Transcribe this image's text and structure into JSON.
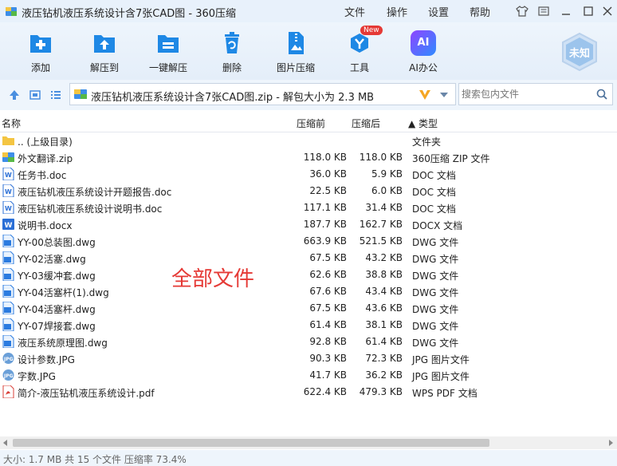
{
  "window": {
    "title": "液压钻机液压系统设计含7张CAD图 - 360压缩",
    "menu": [
      "文件",
      "操作",
      "设置",
      "帮助"
    ]
  },
  "toolbar": {
    "tools": [
      {
        "label": "添加",
        "icon": "add-icon"
      },
      {
        "label": "解压到",
        "icon": "extract-to-icon"
      },
      {
        "label": "一键解压",
        "icon": "one-click-extract-icon"
      },
      {
        "label": "删除",
        "icon": "delete-icon"
      },
      {
        "label": "图片压缩",
        "icon": "image-compress-icon"
      },
      {
        "label": "工具",
        "icon": "tools-icon",
        "badge": "New"
      },
      {
        "label": "AI办公",
        "icon": "ai-office-icon",
        "icon_text": "AI"
      }
    ],
    "profile_label": "未知"
  },
  "address": {
    "path": "液压钻机液压系统设计含7张CAD图.zip - 解包大小为 2.3 MB",
    "search_placeholder": "搜索包内文件"
  },
  "columns": {
    "name": "名称",
    "original": "压缩前",
    "compressed": "压缩后",
    "type": "▲ 类型"
  },
  "files": [
    {
      "name": ".. (上级目录)",
      "size": "",
      "compressed": "",
      "type": "文件夹",
      "icon": "folder-icon"
    },
    {
      "name": "外文翻译.zip",
      "size": "118.0 KB",
      "compressed": "118.0 KB",
      "type": "360压缩 ZIP 文件",
      "icon": "zip-file-icon"
    },
    {
      "name": "任务书.doc",
      "size": "36.0 KB",
      "compressed": "5.9 KB",
      "type": "DOC 文档",
      "icon": "word-doc-icon"
    },
    {
      "name": "液压钻机液压系统设计开题报告.doc",
      "size": "22.5 KB",
      "compressed": "6.0 KB",
      "type": "DOC 文档",
      "icon": "word-doc-icon"
    },
    {
      "name": "液压钻机液压系统设计说明书.doc",
      "size": "117.1 KB",
      "compressed": "31.4 KB",
      "type": "DOC 文档",
      "icon": "word-doc-icon"
    },
    {
      "name": "说明书.docx",
      "size": "187.7 KB",
      "compressed": "162.7 KB",
      "type": "DOCX 文档",
      "icon": "word-docx-icon"
    },
    {
      "name": "YY-00总装图.dwg",
      "size": "663.9 KB",
      "compressed": "521.5 KB",
      "type": "DWG 文件",
      "icon": "dwg-file-icon"
    },
    {
      "name": "YY-02活塞.dwg",
      "size": "67.5 KB",
      "compressed": "43.2 KB",
      "type": "DWG 文件",
      "icon": "dwg-file-icon"
    },
    {
      "name": "YY-03缓冲套.dwg",
      "size": "62.6 KB",
      "compressed": "38.8 KB",
      "type": "DWG 文件",
      "icon": "dwg-file-icon"
    },
    {
      "name": "YY-04活塞杆(1).dwg",
      "size": "67.6 KB",
      "compressed": "43.4 KB",
      "type": "DWG 文件",
      "icon": "dwg-file-icon"
    },
    {
      "name": "YY-04活塞杆.dwg",
      "size": "67.5 KB",
      "compressed": "43.6 KB",
      "type": "DWG 文件",
      "icon": "dwg-file-icon"
    },
    {
      "name": "YY-07焊接套.dwg",
      "size": "61.4 KB",
      "compressed": "38.1 KB",
      "type": "DWG 文件",
      "icon": "dwg-file-icon"
    },
    {
      "name": "液压系统原理图.dwg",
      "size": "92.8 KB",
      "compressed": "61.4 KB",
      "type": "DWG 文件",
      "icon": "dwg-file-icon"
    },
    {
      "name": "设计参数.JPG",
      "size": "90.3 KB",
      "compressed": "72.3 KB",
      "type": "JPG 图片文件",
      "icon": "jpg-file-icon"
    },
    {
      "name": "字数.JPG",
      "size": "41.7 KB",
      "compressed": "36.2 KB",
      "type": "JPG 图片文件",
      "icon": "jpg-file-icon"
    },
    {
      "name": "简介-液压钻机液压系统设计.pdf",
      "size": "622.4 KB",
      "compressed": "479.3 KB",
      "type": "WPS PDF 文档",
      "icon": "pdf-file-icon"
    }
  ],
  "overlay_text": "全部文件",
  "status": "大小: 1.7 MB 共 15 个文件 压缩率 73.4%",
  "colors": {
    "accent": "#1e88e5",
    "overlay": "#e53935",
    "folder": "#f4c542",
    "pdf": "#d9413a"
  }
}
